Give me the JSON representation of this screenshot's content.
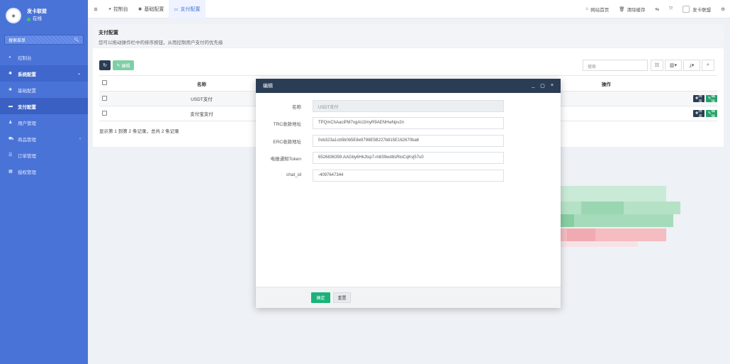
{
  "sidebar": {
    "username": "发卡联盟",
    "status": "在线",
    "search_label": "搜索菜单",
    "items": [
      {
        "label": "控制台",
        "icon": "dashboard-icon"
      },
      {
        "label": "系统配置",
        "icon": "gear-icon"
      },
      {
        "label": "基础配置",
        "icon": "gear-icon"
      },
      {
        "label": "支付配置",
        "icon": "card-icon"
      },
      {
        "label": "用户管理",
        "icon": "user-icon"
      },
      {
        "label": "商品管理",
        "icon": "cart-icon"
      },
      {
        "label": "订单管理",
        "icon": "list-icon"
      },
      {
        "label": "授权管理",
        "icon": "grid-icon"
      }
    ]
  },
  "topbar": {
    "tabs": [
      {
        "label": "控制台",
        "icon": "dashboard-icon"
      },
      {
        "label": "基础配置",
        "icon": "gear-icon"
      },
      {
        "label": "支付配置",
        "icon": "card-icon"
      }
    ],
    "right": {
      "home": "网站首页",
      "clear": "清除缓存",
      "user": "发卡联盟"
    }
  },
  "page": {
    "title": "支付配置",
    "subtitle": "您可以拖动操作栏中的排序按钮，从而控制用户支付的优先级",
    "edit_label": "编辑",
    "search_placeholder": "搜索",
    "table": {
      "headers": [
        "名称",
        "操作"
      ],
      "rows": [
        {
          "name": "USDT支付"
        },
        {
          "name": "支付宝支付"
        }
      ],
      "sort_label": "排序",
      "edit_label": "编辑"
    },
    "pager": "显示第 1 到第 2 条记录，总共 2 条记录"
  },
  "modal": {
    "title": "编辑",
    "fields": [
      {
        "label": "名称",
        "value": "USDT支付",
        "readonly": true
      },
      {
        "label": "TRC收款地址",
        "value": "TPQmChAaciPM7xgAU2myR9AENHwNpv2n"
      },
      {
        "label": "ERC收款地址",
        "value": "0xb323a1cb5b0b5E8e9798E5B227b815E162670ba6"
      },
      {
        "label": "电报通知Token",
        "value": "6526836359:AAGby6HkJtsp7-m839wd8sRtoCqKvj57u0"
      },
      {
        "label": "chat_id",
        "value": "-4097647344"
      }
    ],
    "ok_label": "确定",
    "reset_label": "重置"
  },
  "colors": {
    "sidebar": "#4a73d8",
    "header_dark": "#2b3d55",
    "success": "#1bb37a"
  }
}
